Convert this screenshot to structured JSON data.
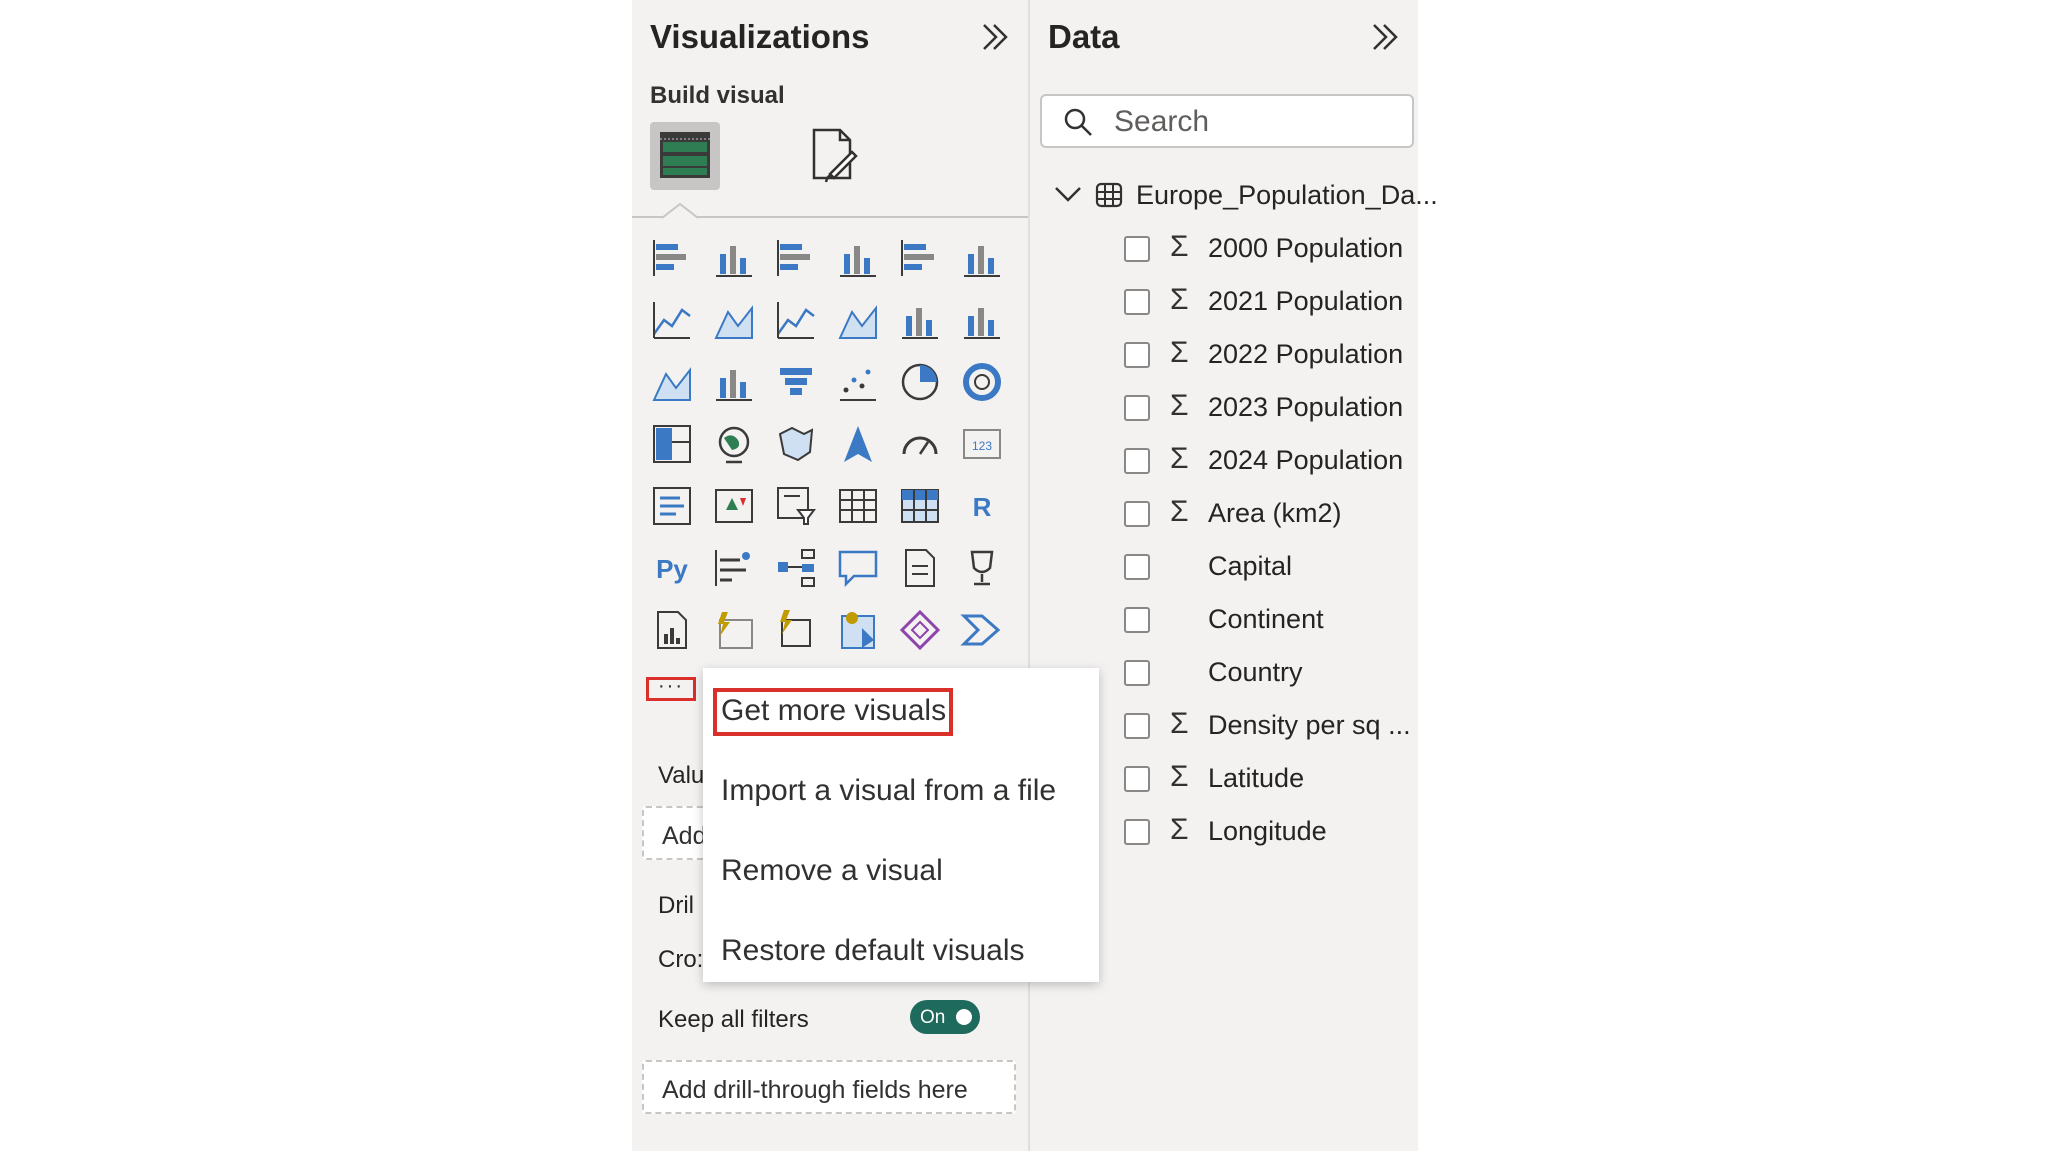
{
  "visualizations": {
    "title": "Visualizations",
    "build_visual": "Build visual",
    "more_label": "···",
    "values_label": "Valu",
    "add_label": "Add",
    "drill_label": "Dril",
    "cross_label": "Cro:",
    "keep_filters_label": "Keep all filters",
    "toggle_label": "On",
    "drillthrough_placeholder": "Add drill-through fields here",
    "icons": [
      "stacked-bar-chart-icon",
      "stacked-column-chart-icon",
      "clustered-bar-chart-icon",
      "clustered-column-chart-icon",
      "100-stacked-bar-chart-icon",
      "100-stacked-column-chart-icon",
      "line-chart-icon",
      "area-chart-icon",
      "stacked-area-chart-icon",
      "100-stacked-area-chart-icon",
      "line-and-stacked-column-icon",
      "line-and-clustered-column-icon",
      "ribbon-chart-icon",
      "waterfall-chart-icon",
      "funnel-chart-icon",
      "scatter-chart-icon",
      "pie-chart-icon",
      "donut-chart-icon",
      "treemap-icon",
      "map-icon",
      "filled-map-icon",
      "azure-map-icon",
      "gauge-icon",
      "card-icon",
      "multi-row-card-icon",
      "kpi-icon",
      "slicer-icon",
      "table-icon",
      "matrix-icon",
      "r-script-visual-icon",
      "python-visual-icon",
      "key-influencers-icon",
      "decomposition-tree-icon",
      "qa-icon",
      "smart-narrative-icon",
      "metrics-icon",
      "paginated-report-icon",
      "power-apps-card-icon",
      "power-apps-slicer-icon",
      "arcgis-map-icon",
      "power-apps-icon",
      "power-automate-icon"
    ]
  },
  "menu": {
    "items": [
      "Get more visuals",
      "Import a visual from a file",
      "Remove a visual",
      "Restore default visuals"
    ]
  },
  "data": {
    "title": "Data",
    "search_placeholder": "Search",
    "table_name": "Europe_Population_Da...",
    "fields": [
      {
        "name": "2000 Population",
        "sigma": "Σ"
      },
      {
        "name": "2021 Population",
        "sigma": "Σ"
      },
      {
        "name": "2022 Population",
        "sigma": "Σ"
      },
      {
        "name": "2023 Population",
        "sigma": "Σ"
      },
      {
        "name": "2024 Population",
        "sigma": "Σ"
      },
      {
        "name": "Area (km2)",
        "sigma": "Σ"
      },
      {
        "name": "Capital",
        "sigma": ""
      },
      {
        "name": "Continent",
        "sigma": ""
      },
      {
        "name": "Country",
        "sigma": ""
      },
      {
        "name": "Density per sq ...",
        "sigma": "Σ"
      },
      {
        "name": "Latitude",
        "sigma": "Σ"
      },
      {
        "name": "Longitude",
        "sigma": "Σ"
      }
    ]
  },
  "colors": {
    "accent_blue": "#3b79c4",
    "highlight_red": "#d9302c",
    "toggle_green": "#1e6a5c",
    "panel_bg": "#f3f2f1"
  }
}
